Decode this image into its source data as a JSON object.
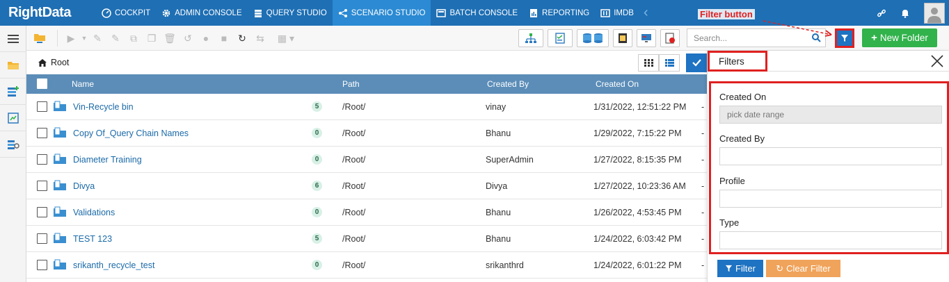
{
  "app": {
    "logo": "RightData"
  },
  "nav": {
    "items": [
      {
        "label": "COCKPIT",
        "icon": "cockpit-icon",
        "active": false
      },
      {
        "label": "ADMIN CONSOLE",
        "icon": "gear-icon",
        "active": false
      },
      {
        "label": "QUERY STUDIO",
        "icon": "database-icon",
        "active": false
      },
      {
        "label": "SCENARIO STUDIO",
        "icon": "scenario-icon",
        "active": true
      },
      {
        "label": "BATCH CONSOLE",
        "icon": "batch-icon",
        "active": false
      },
      {
        "label": "REPORTING",
        "icon": "report-icon",
        "active": false
      },
      {
        "label": "IMDB",
        "icon": "imdb-icon",
        "active": false
      }
    ]
  },
  "toolbar": {
    "search_placeholder": "Search...",
    "new_folder_label": "New Folder"
  },
  "annotation": {
    "filter_button_label": "Filter button"
  },
  "breadcrumb": {
    "root": "Root"
  },
  "table": {
    "columns": [
      "Name",
      "Path",
      "Created By",
      "Created On"
    ],
    "rows": [
      {
        "name": "Vin-Recycle bin",
        "count": "5",
        "path": "/Root/",
        "created_by": "vinay",
        "created_on": "1/31/2022, 12:51:22 PM",
        "extra": "-"
      },
      {
        "name": "Copy Of_Query Chain Names",
        "count": "0",
        "path": "/Root/",
        "created_by": "Bhanu",
        "created_on": "1/29/2022, 7:15:22 PM",
        "extra": "-"
      },
      {
        "name": "Diameter Training",
        "count": "0",
        "path": "/Root/",
        "created_by": "SuperAdmin",
        "created_on": "1/27/2022, 8:15:35 PM",
        "extra": "-"
      },
      {
        "name": "Divya",
        "count": "6",
        "path": "/Root/",
        "created_by": "Divya",
        "created_on": "1/27/2022, 10:23:36 AM",
        "extra": "-"
      },
      {
        "name": "Validations",
        "count": "0",
        "path": "/Root/",
        "created_by": "Bhanu",
        "created_on": "1/26/2022, 4:53:45 PM",
        "extra": "-"
      },
      {
        "name": "TEST 123",
        "count": "5",
        "path": "/Root/",
        "created_by": "Bhanu",
        "created_on": "1/24/2022, 6:03:42 PM",
        "extra": "-"
      },
      {
        "name": "srikanth_recycle_test",
        "count": "0",
        "path": "/Root/",
        "created_by": "srikanthrd",
        "created_on": "1/24/2022, 6:01:22 PM",
        "extra": "-"
      }
    ]
  },
  "filters": {
    "title": "Filters",
    "created_on_label": "Created On",
    "created_on_placeholder": "pick date range",
    "created_by_label": "Created By",
    "profile_label": "Profile",
    "type_label": "Type",
    "filter_button": "Filter",
    "clear_button": "Clear Filter"
  },
  "colors": {
    "nav_bg": "#1e6fb4",
    "nav_active": "#2b8ad3",
    "table_header": "#5b8db8",
    "link": "#1a6aa8",
    "new_folder": "#31b24b",
    "clear_filter": "#f0a35a",
    "annotation": "#e02020"
  }
}
